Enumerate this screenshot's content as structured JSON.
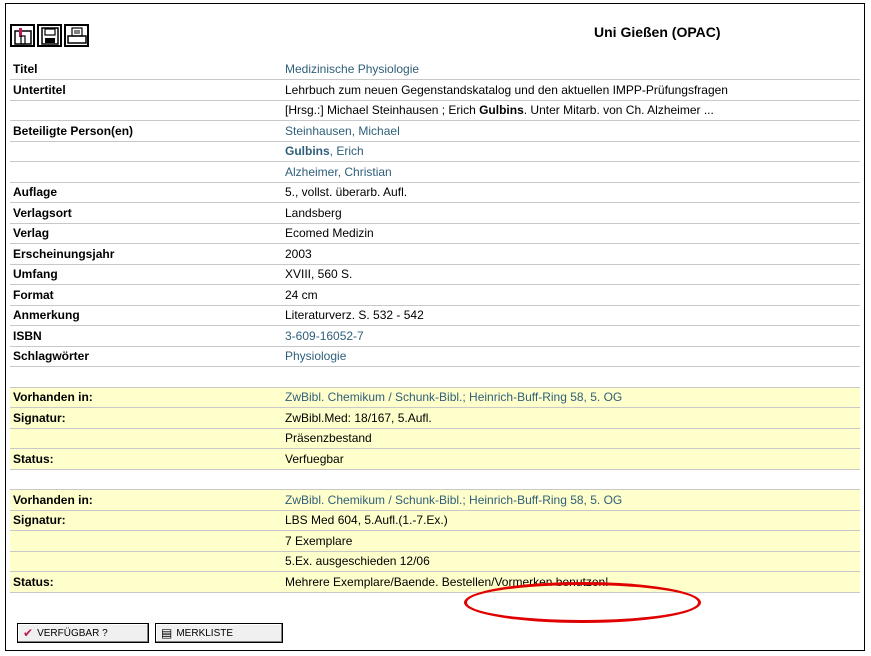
{
  "header": {
    "title": "Uni Gießen (OPAC)",
    "tools": [
      {
        "icon": "building-icon"
      },
      {
        "icon": "floppy-save-icon"
      },
      {
        "icon": "printer-icon"
      }
    ]
  },
  "record": {
    "rows": [
      {
        "label": "Titel",
        "value": "Medizinische Physiologie",
        "link": true
      },
      {
        "label": "Untertitel",
        "value": "Lehrbuch zum neuen Gegenstandskatalog und den aktuellen IMPP-Prüfungsfragen"
      },
      {
        "label": "",
        "value_pre": "[Hrsg.:] Michael Steinhausen ; Erich ",
        "value_bold": "Gulbins",
        "value_post": ". Unter Mitarb. von Ch. Alzheimer ..."
      },
      {
        "label": "Beteiligte Person(en)",
        "value": "Steinhausen, Michael",
        "link": true
      },
      {
        "label": "",
        "value_bold": "Gulbins",
        "value_post": ", Erich",
        "link": true
      },
      {
        "label": "",
        "value": "Alzheimer, Christian",
        "link": true
      },
      {
        "label": "Auflage",
        "value": "5., vollst. überarb. Aufl."
      },
      {
        "label": "Verlagsort",
        "value": "Landsberg"
      },
      {
        "label": "Verlag",
        "value": "Ecomed Medizin"
      },
      {
        "label": "Erscheinungsjahr",
        "value": "2003"
      },
      {
        "label": "Umfang",
        "value": "XVIII, 560 S."
      },
      {
        "label": "Format",
        "value": "24 cm"
      },
      {
        "label": "Anmerkung",
        "value": "Literaturverz. S. 532 - 542"
      },
      {
        "label": "ISBN",
        "value": "3-609-16052-7",
        "link": true
      },
      {
        "label": "Schlagwörter",
        "value": "Physiologie",
        "link": true
      }
    ]
  },
  "holdings": [
    {
      "vorhanden_label": "Vorhanden in:",
      "vorhanden_value": "ZwBibl. Chemikum / Schunk-Bibl.; Heinrich-Buff-Ring 58, 5. OG",
      "signatur_label": "Signatur:",
      "signatur_lines": [
        "ZwBibl.Med: 18/167, 5.Aufl.",
        "Präsenzbestand"
      ],
      "status_label": "Status:",
      "status_value": "Verfuegbar"
    },
    {
      "vorhanden_label": "Vorhanden in:",
      "vorhanden_value": "ZwBibl. Chemikum / Schunk-Bibl.; Heinrich-Buff-Ring 58, 5. OG",
      "signatur_label": "Signatur:",
      "signatur_lines": [
        "LBS Med 604, 5.Aufl.(1.-7.Ex.)",
        "7 Exemplare",
        "5.Ex. ausgeschieden 12/06"
      ],
      "status_label": "Status:",
      "status_value": "Mehrere Exemplare/Baende. Bestellen/Vormerken benutzen!"
    }
  ],
  "buttons": {
    "verfuegbar": "VERFÜGBAR ?",
    "merkliste": "MERKLISTE"
  },
  "colors": {
    "link": "#2f5f7a",
    "holding_bg": "#ffffcc",
    "highlight_ellipse": "#e00000"
  }
}
